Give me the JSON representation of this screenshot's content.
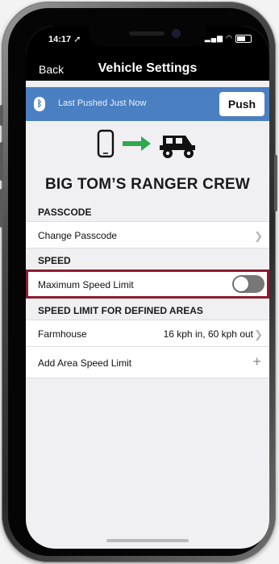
{
  "status_bar": {
    "time": "14:17",
    "time_icon": "location-arrow-icon",
    "icons": "signal wifi battery"
  },
  "nav": {
    "back_label": "Back",
    "title": "Vehicle Settings"
  },
  "push_bar": {
    "icon": "bluetooth-icon",
    "message": "Last Pushed Just Now",
    "push_label": "Push",
    "color": "#4a7fc2"
  },
  "hero": {
    "phone_icon": "phone-icon",
    "arrow_icon": "right-arrow-icon",
    "arrow_color": "#2fa84f",
    "vehicle_icon": "utv-icon",
    "crew_name": "BIG TOM’S RANGER CREW"
  },
  "sections": {
    "passcode": {
      "header": "PASSCODE",
      "change_label": "Change Passcode"
    },
    "speed": {
      "header": "SPEED",
      "max_limit_label": "Maximum Speed Limit",
      "max_limit_enabled": false,
      "highlight_color": "#8c1d30"
    },
    "areas": {
      "header": "SPEED LIMIT FOR DEFINED AREAS",
      "items": [
        {
          "name": "Farmhouse",
          "value": "16 kph in, 60 kph out"
        }
      ],
      "add_label": "Add Area Speed Limit",
      "add_icon": "plus-icon"
    }
  }
}
